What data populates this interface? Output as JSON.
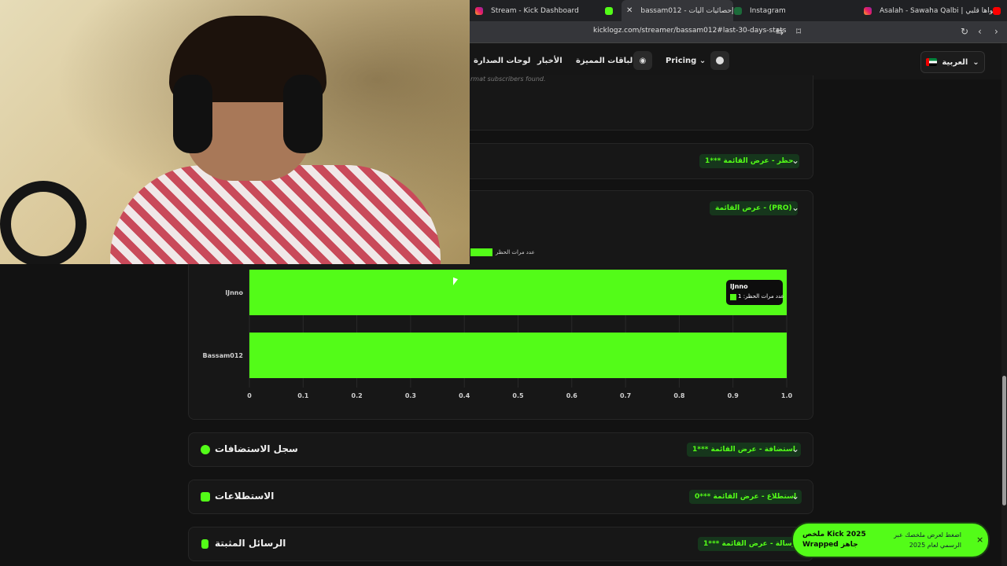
{
  "browser": {
    "tabs": [
      {
        "label": "Stream - Kick Dashboard",
        "icon": "instagram-icon"
      },
      {
        "label": "bassam012 - إحصائيات اليات",
        "icon": "kick-icon",
        "active": true
      },
      {
        "label": "Instagram",
        "icon": "kicklogz-icon"
      },
      {
        "label": "Asalah - Sawaha Qalbi | سواها قلبي",
        "icon": "instagram-icon"
      }
    ],
    "url": "kicklogz.com/streamer/bassam012#last-30-days-stats"
  },
  "nav": {
    "items": [
      "لوحات الصدارة",
      "الأخبار",
      "الباقات المميزة",
      "Pricing"
    ],
    "language": "العربية"
  },
  "faded_line": "rmat subscribers found.",
  "sections": {
    "bans_badge": "حظر - عرض القائمة ***1",
    "pro_badge": "عرض القائمة - (PRO)",
    "hosts_title": "سجل الاستضافات",
    "hosts_badge": "استضافة - عرض القائمة ***1",
    "polls_title": "الاستطلاعات",
    "polls_badge": "استطلاع - عرض القائمة ***0",
    "pinned_title": "الرسائل المثبتة",
    "pinned_badge": "رسالة - عرض القائمة ***1"
  },
  "chart_data": {
    "type": "bar",
    "orientation": "horizontal",
    "categories": [
      "lJnno",
      "Bassam012"
    ],
    "series": [
      {
        "name": "عدد مرات الحظر",
        "values": [
          1,
          1
        ]
      }
    ],
    "xlim": [
      0,
      1.0
    ],
    "xticks": [
      "0",
      "0.1",
      "0.2",
      "0.3",
      "0.4",
      "0.5",
      "0.6",
      "0.7",
      "0.8",
      "0.9",
      "1.0"
    ],
    "legend_position": "top-left",
    "bar_color": "#53fc18"
  },
  "tooltip": {
    "title": "lJnno",
    "label": "عدد مرات الحظر: 1"
  },
  "toast": {
    "title": "ملخص Kick 2025 Wrapped جاهز",
    "description": "اضغط لعرض ملخصك عبر الرسمي لعام 2025",
    "close": "×"
  },
  "colors": {
    "accent": "#53fc18",
    "background": "#121212",
    "card": "#171717"
  }
}
